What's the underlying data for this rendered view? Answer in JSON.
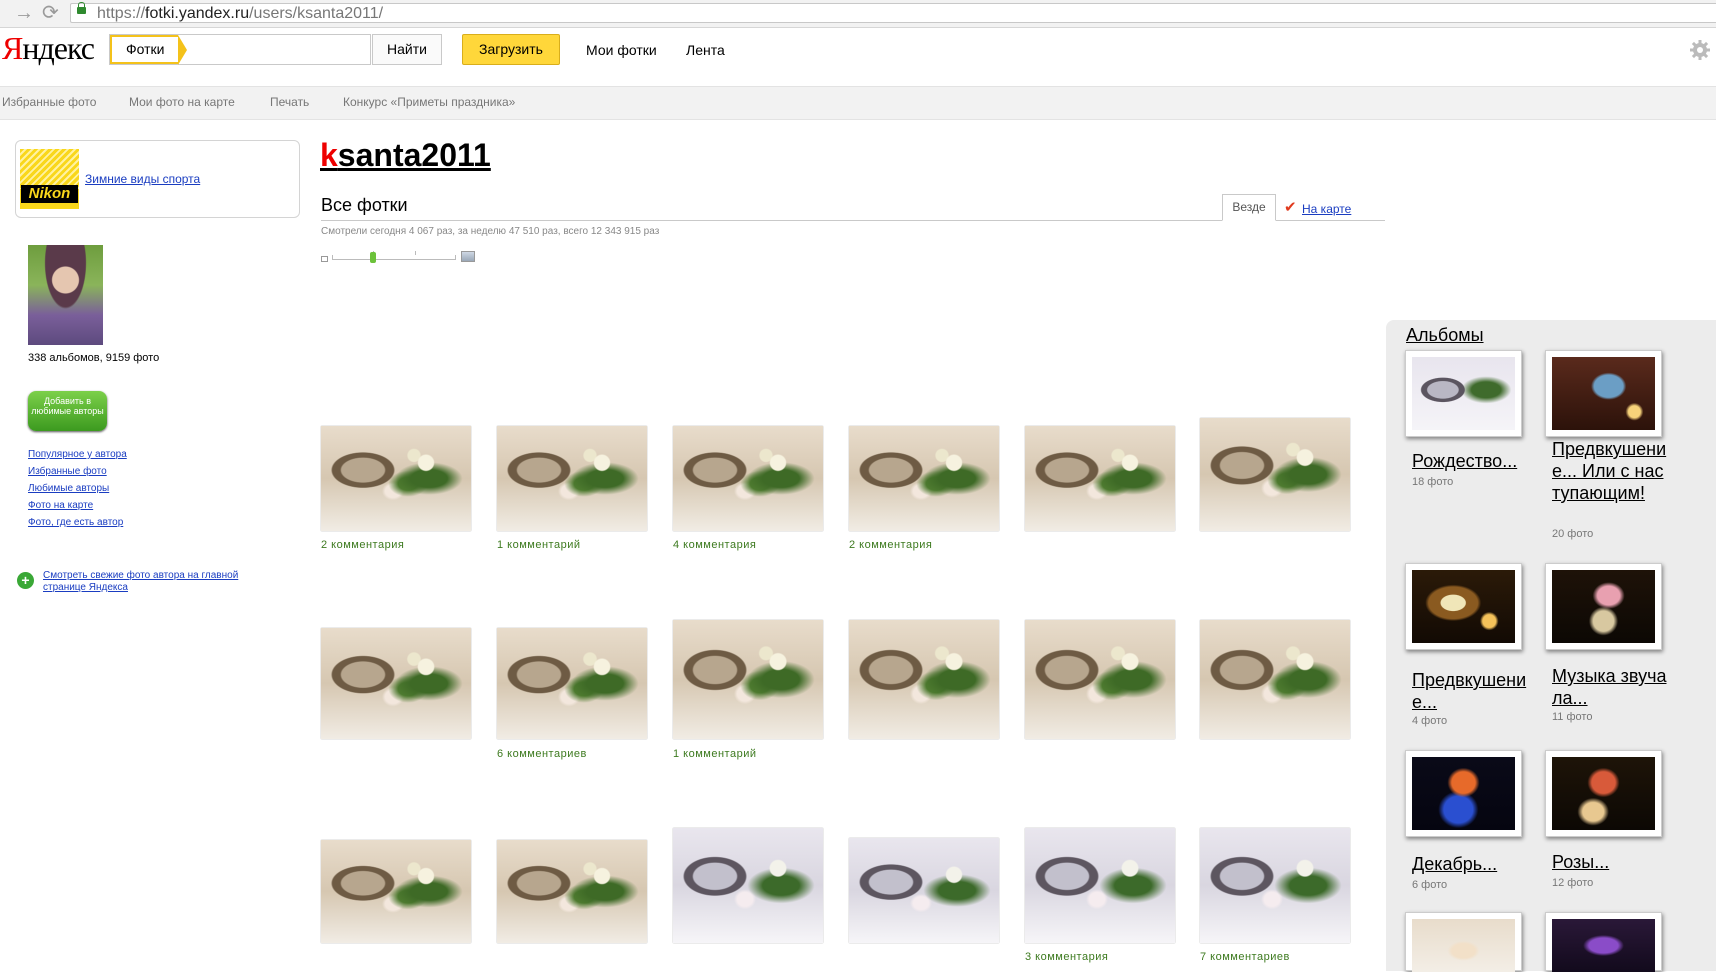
{
  "browser": {
    "url_scheme": "https://",
    "url_host": "fotki.yandex.ru",
    "url_path": "/users/ksanta2011/"
  },
  "header": {
    "logo": "Яндекс",
    "service": "Фотки",
    "search_button": "Найти",
    "upload_button": "Загрузить",
    "links": [
      "Мои фотки",
      "Лента"
    ]
  },
  "subnav": [
    "Избранные фото",
    "Мои фото на карте",
    "Печать",
    "Конкурс «Приметы праздника»"
  ],
  "sidebar": {
    "ad": {
      "brand": "Nikon",
      "link": "Зимние виды спорта"
    },
    "stats": "338 альбомов, 9159 фото",
    "add_button": "Добавить в любимые авторы",
    "links": [
      "Популярное у автора",
      "Избранные фото",
      "Любимые авторы",
      "Фото на карте",
      "Фото, где есть автор"
    ],
    "fresh_link": "Смотреть свежие фото автора на главной странице Яндекса"
  },
  "main": {
    "username": "ksanta2011",
    "username_first": "k",
    "username_rest": "santa2011",
    "section_title": "Все фотки",
    "tabs": [
      "Везде",
      "На карте"
    ],
    "views": "Смотрели сегодня 4 067 раз, за неделю 47 510 раз, всего 12 343 915 раз",
    "comments": {
      "r1c1": "2 комментария",
      "r1c2": "1 комментарий",
      "r1c3": "4 комментария",
      "r1c4": "2 комментария",
      "r2c2": "6 комментариев",
      "r2c3": "1 комментарий",
      "r3c5": "3 комментария",
      "r3c6": "7 комментариев"
    }
  },
  "albums": {
    "title": "Альбомы",
    "items": [
      {
        "name": "Рождество...",
        "count": "18 фото"
      },
      {
        "name": "Предвкушение... Или с наступающим!",
        "count": "20 фото"
      },
      {
        "name": "Предвкушение...",
        "count": "4 фото"
      },
      {
        "name": "Музыка звучала...",
        "count": "11 фото"
      },
      {
        "name": "Декабрь...",
        "count": "6 фото"
      },
      {
        "name": "Розы...",
        "count": "12 фото"
      }
    ]
  },
  "colors": {
    "accent_yellow": "#ffd73a",
    "link_blue": "#1a3dc1",
    "comment_green": "#3d7a1f",
    "logo_red": "#ee0000"
  }
}
